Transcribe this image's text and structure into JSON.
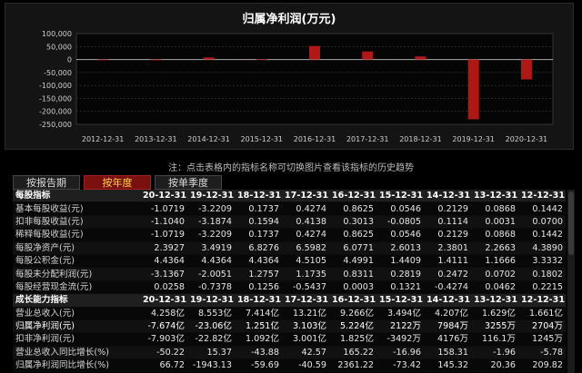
{
  "chart": {
    "title": "归属净利润(万元)"
  },
  "chart_data": {
    "type": "bar",
    "title": "归属净利润(万元)",
    "categories": [
      "2012-12-31",
      "2013-12-31",
      "2014-12-31",
      "2015-12-31",
      "2016-12-31",
      "2017-12-31",
      "2018-12-31",
      "2019-12-31",
      "2020-12-31"
    ],
    "values": [
      -500,
      -1200,
      8000,
      2000,
      52000,
      31000,
      12000,
      -230600,
      -76740
    ],
    "ylim": [
      -250000,
      100000
    ],
    "yticks": [
      "100,000",
      "50,000",
      "0",
      "-50,000",
      "-100,000",
      "-150,000",
      "-200,000",
      "-250,000"
    ],
    "ytick_values": [
      100000,
      50000,
      0,
      -50000,
      -100000,
      -150000,
      -200000,
      -250000
    ],
    "bar_color": "#b01818",
    "grid": true
  },
  "note": "注：点击表格内的指标名称可切换图片查看该指标的历史趋势",
  "tabs": [
    {
      "label": "按报告期"
    },
    {
      "label": "按年度"
    },
    {
      "label": "按单季度"
    }
  ],
  "table": {
    "sections": [
      {
        "title": "每股指标",
        "headers": [
          "20-12-31",
          "19-12-31",
          "18-12-31",
          "17-12-31",
          "16-12-31",
          "15-12-31",
          "14-12-31",
          "13-12-31",
          "12-12-31"
        ],
        "rows": [
          {
            "label": "基本每股收益(元)",
            "values": [
              "-1.0719",
              "-3.2209",
              "0.1737",
              "0.4274",
              "0.8625",
              "0.0546",
              "0.2129",
              "0.0868",
              "0.1442"
            ]
          },
          {
            "label": "扣非每股收益(元)",
            "values": [
              "-1.1040",
              "-3.1874",
              "0.1594",
              "0.4138",
              "0.3013",
              "-0.0805",
              "0.1114",
              "0.0031",
              "0.0700"
            ]
          },
          {
            "label": "稀释每股收益(元)",
            "values": [
              "-1.0719",
              "-3.2209",
              "0.1737",
              "0.4274",
              "0.8625",
              "0.0546",
              "0.2129",
              "0.0868",
              "0.1442"
            ]
          },
          {
            "label": "每股净资产(元)",
            "values": [
              "2.3927",
              "3.4919",
              "6.8276",
              "6.5982",
              "6.0771",
              "2.6013",
              "2.3801",
              "2.2663",
              "4.3890"
            ]
          },
          {
            "label": "每股公积金(元)",
            "values": [
              "4.4364",
              "4.4364",
              "4.4364",
              "4.5105",
              "4.4991",
              "1.4409",
              "1.4111",
              "1.1666",
              "3.3332"
            ]
          },
          {
            "label": "每股未分配利润(元)",
            "values": [
              "-3.1367",
              "-2.0051",
              "1.2757",
              "1.1735",
              "0.8311",
              "0.2819",
              "0.2472",
              "0.0702",
              "0.1802"
            ]
          },
          {
            "label": "每股经营现金流(元)",
            "values": [
              "0.0258",
              "-0.7378",
              "0.1256",
              "-0.5437",
              "0.0003",
              "0.1321",
              "-0.4274",
              "0.0462",
              "0.2215"
            ]
          }
        ]
      },
      {
        "title": "成长能力指标",
        "headers": [
          "20-12-31",
          "19-12-31",
          "18-12-31",
          "17-12-31",
          "16-12-31",
          "15-12-31",
          "14-12-31",
          "13-12-31",
          "12-12-31"
        ],
        "rows": [
          {
            "label": "营业总收入(元)",
            "values": [
              "4.258亿",
              "8.553亿",
              "7.414亿",
              "13.21亿",
              "9.266亿",
              "3.494亿",
              "4.207亿",
              "1.629亿",
              "1.661亿"
            ]
          },
          {
            "label": "归属净利润(元)",
            "highlight": true,
            "values": [
              "-7.674亿",
              "-23.06亿",
              "1.251亿",
              "3.103亿",
              "5.224亿",
              "2122万",
              "7984万",
              "3255万",
              "2704万"
            ]
          },
          {
            "label": "扣非净利润(元)",
            "values": [
              "-7.903亿",
              "-22.82亿",
              "1.092亿",
              "3.001亿",
              "1.825亿",
              "-3492万",
              "4176万",
              "116.1万",
              "1245万"
            ]
          },
          {
            "label": "营业总收入同比增长(%)",
            "values": [
              "-50.22",
              "15.37",
              "-43.88",
              "42.57",
              "165.22",
              "-16.96",
              "158.31",
              "-1.96",
              "-5.78"
            ]
          },
          {
            "label": "归属净利润同比增长(%)",
            "values": [
              "66.72",
              "-1943.13",
              "-59.69",
              "-40.59",
              "2361.22",
              "-73.42",
              "145.32",
              "20.36",
              "209.82"
            ]
          }
        ]
      }
    ]
  }
}
